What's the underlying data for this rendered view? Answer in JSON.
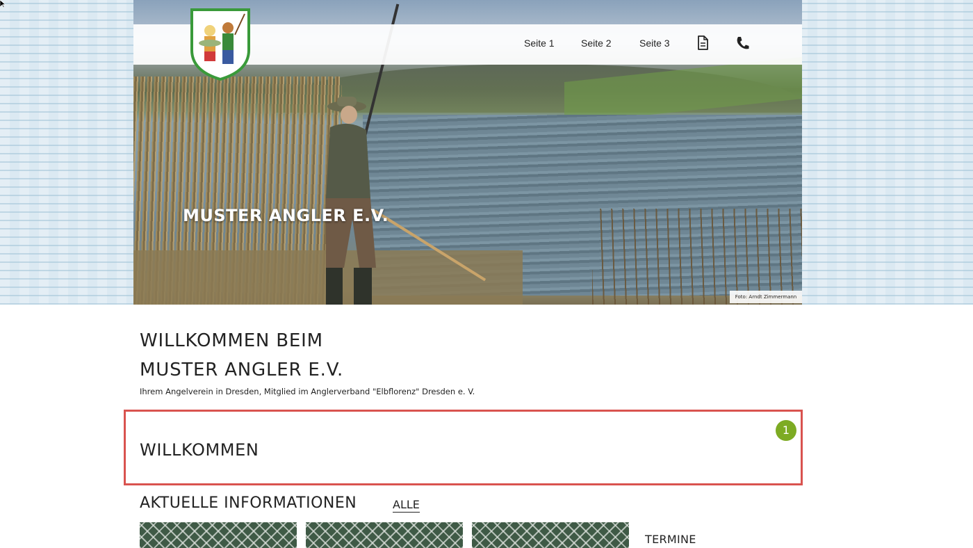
{
  "nav": {
    "items": [
      {
        "label": "Seite 1"
      },
      {
        "label": "Seite 2"
      },
      {
        "label": "Seite 3"
      }
    ],
    "document_icon": "document-icon",
    "phone_icon": "phone-icon"
  },
  "hero": {
    "title": "MUSTER ANGLER E.V.",
    "photo_credit": "Foto: Arndt Zimmermann"
  },
  "welcome": {
    "line1": "WILLKOMMEN BEIM",
    "line2": "MUSTER ANGLER E.V.",
    "subtitle": "Ihrem Angelverein in Dresden, Mitglied im Anglerverband \"Elbflorenz\" Dresden e. V."
  },
  "highlight": {
    "title": "WILLKOMMEN",
    "badge": "1",
    "border_color": "#d9534f /* highlight-box border */",
    "badge_color": "#7dab23 /* step-badge bg */"
  },
  "news": {
    "title": "AKTUELLE INFORMATIONEN",
    "all_link": "ALLE",
    "side_heading": "TERMINE"
  }
}
